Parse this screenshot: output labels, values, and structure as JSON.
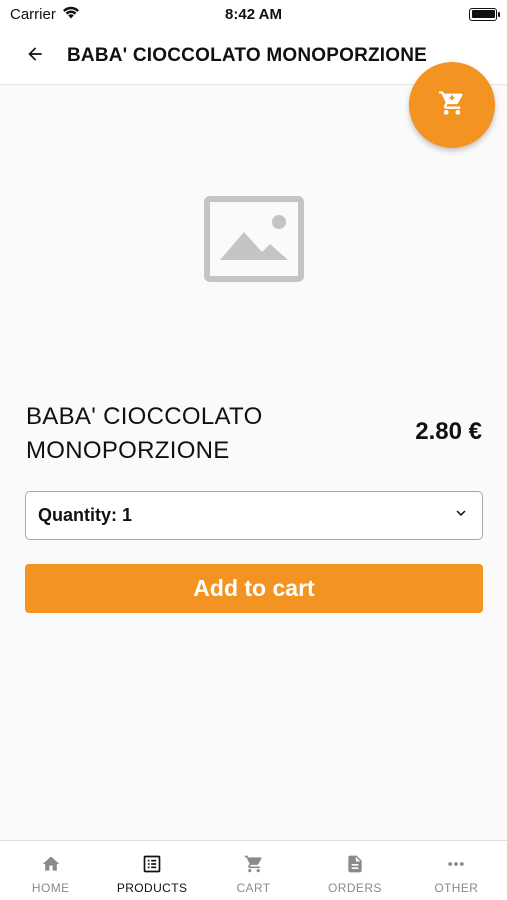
{
  "status_bar": {
    "carrier": "Carrier",
    "time": "8:42 AM"
  },
  "app_bar": {
    "title": "BABA' CIOCCOLATO MONOPORZIONE"
  },
  "product": {
    "name": "BABA' CIOCCOLATO MONOPORZIONE",
    "price": "2.80 €",
    "image_placeholder_icon": "image-placeholder-icon"
  },
  "quantity": {
    "label": "Quantity: 1"
  },
  "actions": {
    "add_to_cart": "Add to cart"
  },
  "bottom_nav": {
    "items": [
      {
        "label": "HOME",
        "icon": "home-icon"
      },
      {
        "label": "PRODUCTS",
        "icon": "list-icon"
      },
      {
        "label": "CART",
        "icon": "cart-icon"
      },
      {
        "label": "ORDERS",
        "icon": "document-icon"
      },
      {
        "label": "OTHER",
        "icon": "more-icon"
      }
    ],
    "active_index": 1
  },
  "colors": {
    "accent": "#f39322",
    "inactive": "#8a8a8a"
  }
}
